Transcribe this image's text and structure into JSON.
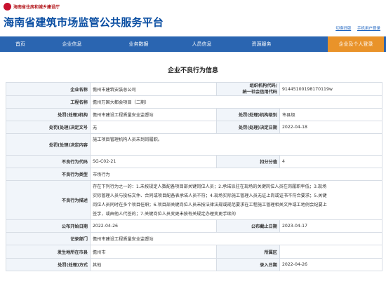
{
  "top": {
    "ministry": "海南省住房和城乡建设厅",
    "logo_icon": "ministry-emblem-icon"
  },
  "header": {
    "site_title": "海南省建筑市场监管公共服务平台",
    "links": [
      "切换旧版",
      "手机用户登录"
    ]
  },
  "nav": {
    "items": [
      "首页",
      "企业信息",
      "业务数据",
      "人员信息",
      "资源服务"
    ],
    "login": "企业及个人登录",
    "bg_color": "#2a65b1",
    "login_color": "#e9932a"
  },
  "page": {
    "heading": "企业不良行为信息"
  },
  "record": {
    "company_label": "企业名称",
    "company": "儋州市建筑安装总公司",
    "org_code_label_1": "组织机构代码/",
    "org_code_label_2": "统一社会信用代码",
    "org_code": "91445100198170119w",
    "project_label": "工程名称",
    "project": "儋州万国大都会项目（二期）",
    "handler_label": "处罚(处理)机构",
    "handler": "儋州市建设工程质量安全监督站",
    "handler_level_label": "处罚(处理)机构级别",
    "handler_level": "市县级",
    "decision_no_label": "处罚(处理)决定文号",
    "decision_no": "无",
    "decision_date_label": "处罚(处理)决定日期",
    "decision_date": "2022-04-18",
    "decision_content_label": "处罚(处理)决定内容",
    "decision_content": "施工项目管理机构人员未到岗履职。",
    "code_label": "不良行为代码",
    "code": "SG-C02-21",
    "score_label": "扣分分值",
    "score": "4",
    "type_label": "不良行为类型",
    "type": "市场行为",
    "desc_label": "不良行为描述",
    "desc_lines": [
      "存在下列行为之一的：1.未按规定人数配备项目部关键岗位人员；2.承诺派驻在现场的关键岗位人员在岗履职率低；3.现场",
      "实际管理人员与投标文件、合同或项目配备表承诺人员不符；4.现场实际施工管理人员无证上岗或证书不符合要求；5.关键",
      "岗位人员同时在多个项目任职；6.项目部关键岗位人员未按法律法规或规范要求在工程施工管理相关文件或工地例会纪要上",
      "签字，或由他人代签的；7.关键岗位人员变更未按有关规定办理变更手续的"
    ],
    "publish_start_label": "公布开始日期",
    "publish_start": "2022-04-26",
    "publish_end_label": "公布截止日期",
    "publish_end": "2023-04-17",
    "recorder_label": "记录部门",
    "recorder": "儋州市建设工程质量安全监督站",
    "place_label": "发生地所在市县",
    "place": "儋州市",
    "region_label": "所属区",
    "region": "",
    "other_label": "处罚(处理)方式",
    "other": "其他",
    "entry_date_label": "录入日期",
    "entry_date": "2022-04-26"
  }
}
